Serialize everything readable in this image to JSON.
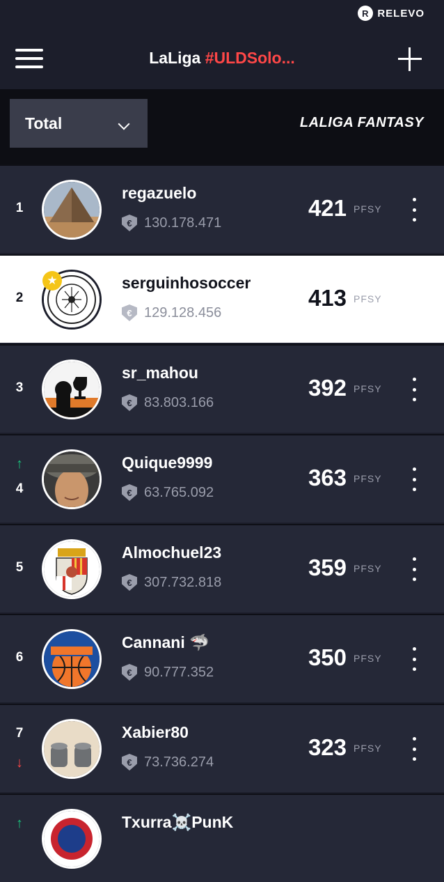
{
  "brand": {
    "name": "RELEVO",
    "logo_icon": "relevo-logo-icon"
  },
  "header": {
    "title_plain": "LaLiga ",
    "title_highlight": "#ULDSolo...",
    "highlight_color": "#ff4747",
    "menu_icon": "hamburger-menu-icon",
    "add_icon": "plus-icon"
  },
  "filter": {
    "selected": "Total",
    "chevron_icon": "chevron-down-icon",
    "logo_text": "LALIGA FANTASY"
  },
  "ranking": {
    "unit": "PFSY",
    "rows": [
      {
        "rank": "1",
        "trend": "",
        "name": "regazuelo",
        "value": "130.178.471",
        "points": "421",
        "avatar": "pyramid-photo",
        "is_me": false
      },
      {
        "rank": "2",
        "trend": "",
        "name": "serguinhosoccer",
        "value": "129.128.456",
        "points": "413",
        "avatar": "football-crest",
        "is_me": true
      },
      {
        "rank": "3",
        "trend": "",
        "name": "sr_mahou",
        "value": "83.803.166",
        "points": "392",
        "avatar": "trophy-silhouette",
        "is_me": false
      },
      {
        "rank": "4",
        "trend": "up",
        "name": "Quique9999",
        "value": "63.765.092",
        "points": "363",
        "avatar": "man-with-cap",
        "is_me": false
      },
      {
        "rank": "5",
        "trend": "",
        "name": "Almochuel23",
        "value": "307.732.818",
        "points": "359",
        "avatar": "coat-of-arms",
        "is_me": false
      },
      {
        "rank": "6",
        "trend": "",
        "name": "Cannani 🦈",
        "value": "90.777.352",
        "points": "350",
        "avatar": "knicks-logo",
        "is_me": false
      },
      {
        "rank": "7",
        "trend": "down",
        "name": "Xabier80",
        "value": "73.736.274",
        "points": "323",
        "avatar": "metal-parts",
        "is_me": false
      },
      {
        "rank": "",
        "trend": "up",
        "name": "Txurra☠️PunK",
        "value": "",
        "points": "",
        "avatar": "punk-avatar",
        "is_me": false
      }
    ]
  },
  "colors": {
    "background": "#1c1e2b",
    "row": "#252837",
    "highlight_row": "#ffffff",
    "up": "#19c37d",
    "down": "#ff4747"
  },
  "icons": {
    "euro": "euro-shield-icon",
    "more": "more-vertical-icon",
    "up": "arrow-up-icon",
    "down": "arrow-down-icon",
    "favorite": "star-badge-icon"
  }
}
